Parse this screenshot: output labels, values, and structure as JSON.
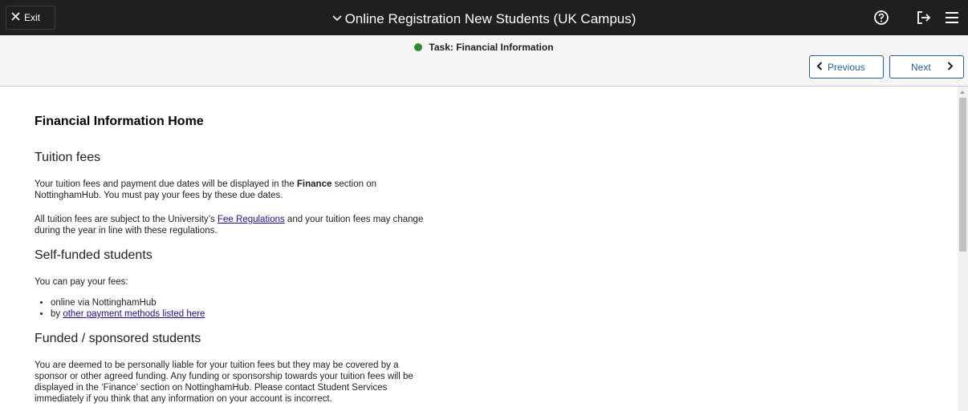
{
  "topbar": {
    "exit_label": "Exit",
    "title": "Online Registration New Students (UK Campus)",
    "icons": [
      "help-icon",
      "signout-icon",
      "menu-icon"
    ]
  },
  "subbar": {
    "task_label": "Task: Financial Information",
    "previous_label": "Previous",
    "next_label": "Next"
  },
  "content": {
    "page_title": "Financial Information Home",
    "tuition": {
      "heading": "Tuition fees",
      "p1_before": "Your tuition fees and payment due dates will be displayed in the ",
      "p1_bold": "Finance",
      "p1_after": " section on NottinghamHub. You must pay your fees by these due dates.",
      "p2_before": "All tuition fees are subject to the University’s ",
      "p2_link": "Fee Regulations",
      "p2_after": "  and your tuition fees may change during the year in line with these regulations."
    },
    "self_funded": {
      "heading": "Self-funded students",
      "intro": "You can pay your fees:",
      "item1": "online via NottinghamHub",
      "item2_before": "by ",
      "item2_link": "other payment methods listed here"
    },
    "funded": {
      "heading": "Funded / sponsored students",
      "para": "You are deemed to be personally liable for your tuition fees but they may be covered by a sponsor or other agreed funding. Any funding or sponsorship towards your tuition fees will be displayed in the ‘Finance’ section on NottinghamHub. Please contact Student Services immediately if you think that any information on your account is incorrect."
    }
  },
  "colors": {
    "topbar_bg": "#1f1f1f",
    "accent_blue": "#1f5fa8",
    "status_green": "#2e8b2e",
    "link": "#1a0dab"
  }
}
